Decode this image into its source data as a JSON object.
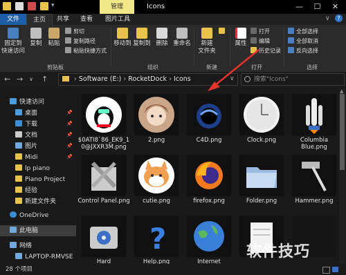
{
  "titlebar": {
    "manage_tab": "管理",
    "window_title": "Icons",
    "minimize": "—",
    "maximize": "☐",
    "close": "✕"
  },
  "ribbon_tabs": [
    "文件",
    "主页",
    "共享",
    "查看",
    "图片工具"
  ],
  "ribbon": {
    "pin_quick_access": "固定到\n快速访问",
    "copy": "复制",
    "paste": "粘贴",
    "cut": "剪切",
    "copy_path": "复制路径",
    "paste_shortcut": "粘贴快捷方式",
    "move_to": "移动到",
    "copy_to": "复制到",
    "delete": "删除",
    "rename": "重命名",
    "new_folder": "新建\n文件夹",
    "properties": "属性",
    "open": "打开",
    "edit": "编辑",
    "history": "历史记录",
    "select_all": "全部选择",
    "select_none": "全部取消",
    "invert_selection": "反向选择",
    "group_clipboard": "剪贴板",
    "group_organize": "组织",
    "group_new": "新建",
    "group_open": "打开",
    "group_select": "选择"
  },
  "address": {
    "back": "←",
    "forward": "→",
    "recent": "∨",
    "up": "↑",
    "path": [
      "Software (E:)",
      "RocketDock",
      "Icons"
    ],
    "separator": "›",
    "search_placeholder": "搜索\"Icons\""
  },
  "sidebar": [
    {
      "label": "快速访问",
      "icon": "star-icon",
      "pinned": false
    },
    {
      "label": "桌面",
      "icon": "desktop-icon",
      "pinned": true
    },
    {
      "label": "下载",
      "icon": "download-icon",
      "pinned": true
    },
    {
      "label": "文档",
      "icon": "document-icon",
      "pinned": true
    },
    {
      "label": "图片",
      "icon": "picture-icon",
      "pinned": true
    },
    {
      "label": "Midi",
      "icon": "folder-icon",
      "pinned": true
    },
    {
      "label": "lp piano",
      "icon": "folder-icon",
      "pinned": false
    },
    {
      "label": "Piano Project",
      "icon": "folder-icon",
      "pinned": false
    },
    {
      "label": "经验",
      "icon": "folder-icon",
      "pinned": false
    },
    {
      "label": "新建文件夹",
      "icon": "folder-icon",
      "pinned": false
    },
    {
      "label": "OneDrive",
      "icon": "cloud-icon",
      "pinned": false
    },
    {
      "label": "此电脑",
      "icon": "computer-icon",
      "pinned": false
    },
    {
      "label": "网络",
      "icon": "network-icon",
      "pinned": false
    },
    {
      "label": "LAPTOP-RMVSE",
      "icon": "computer-icon",
      "pinned": false
    }
  ],
  "pin_glyph": "📌",
  "files": [
    {
      "name": "$0ATI8`86_EK9_10@JXXR3M.png"
    },
    {
      "name": "2.png"
    },
    {
      "name": "C4D.png"
    },
    {
      "name": "Clock.png"
    },
    {
      "name": "Columbia Blue.png"
    },
    {
      "name": "Control Panel.png"
    },
    {
      "name": "cutie.png"
    },
    {
      "name": "firefox.png"
    },
    {
      "name": "Folder.png"
    },
    {
      "name": "Hammer.png"
    },
    {
      "name": "Hard"
    },
    {
      "name": "Help.png"
    },
    {
      "name": "Internet"
    },
    {
      "name": ""
    },
    {
      "name": ""
    }
  ],
  "status": {
    "count": "28 个项目"
  },
  "watermark": "软件技巧",
  "colors": {
    "accent": "#1e5ea8",
    "manage_tab": "#f2e887",
    "annotation_arrow": "#e2342b"
  }
}
